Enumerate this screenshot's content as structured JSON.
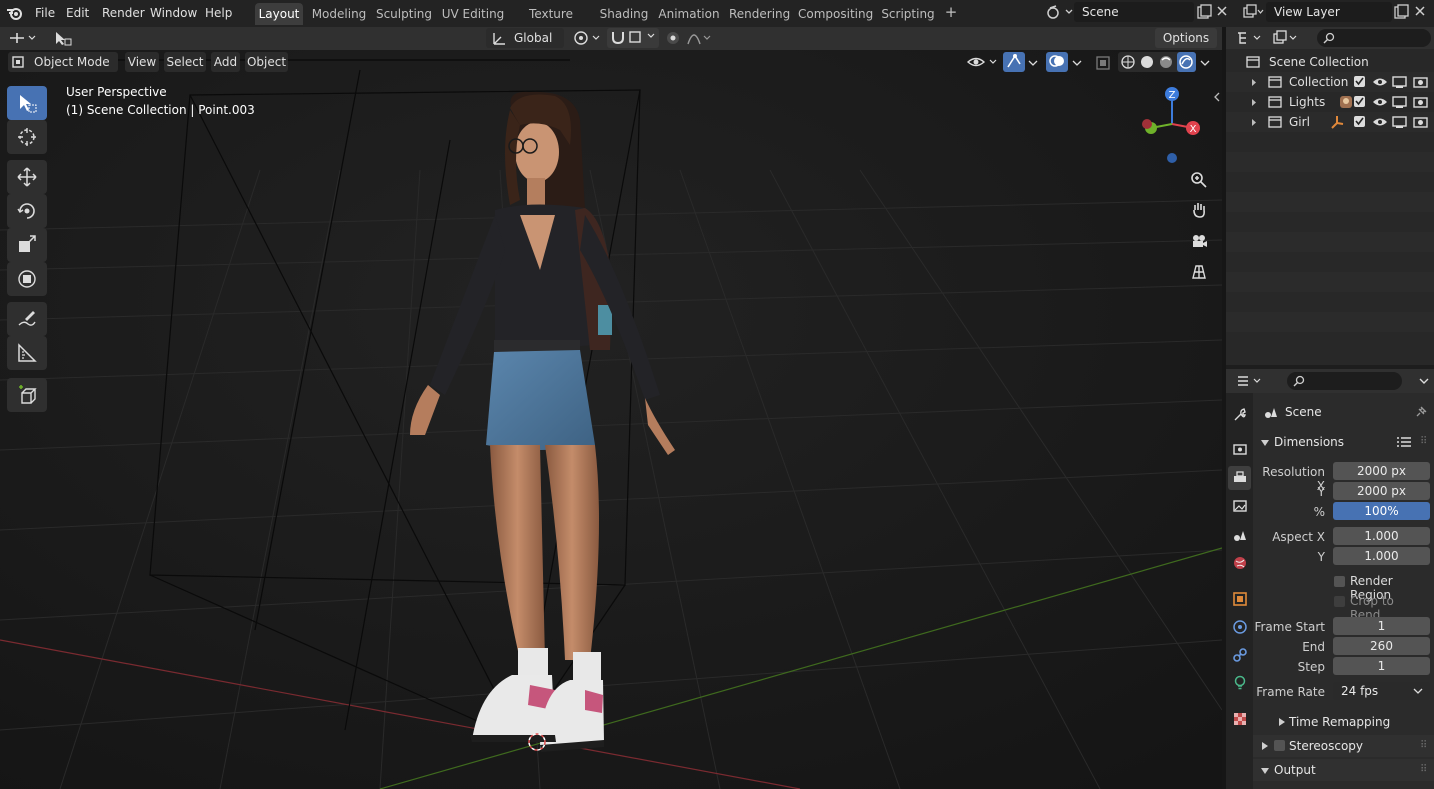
{
  "topbar": {
    "menus": [
      "File",
      "Edit",
      "Render",
      "Window",
      "Help"
    ],
    "workspaces": [
      "Layout",
      "Modeling",
      "Sculpting",
      "UV Editing",
      "Texture Paint",
      "Shading",
      "Animation",
      "Rendering",
      "Compositing",
      "Scripting"
    ],
    "active_workspace": "Layout",
    "scene_name": "Scene",
    "view_layer": "View Layer"
  },
  "viewport_header": {
    "orientation": "Global",
    "options": "Options",
    "mode": "Object Mode",
    "menus": [
      "View",
      "Select",
      "Add",
      "Object"
    ]
  },
  "viewport": {
    "perspective": "User Perspective",
    "context": "(1) Scene Collection | Point.003",
    "gizmo": {
      "z": "Z",
      "x": "X"
    }
  },
  "outliner": {
    "root": "Scene Collection",
    "items": [
      {
        "name": "Collection"
      },
      {
        "name": "Lights"
      },
      {
        "name": "Girl"
      }
    ]
  },
  "properties": {
    "context": "Scene",
    "dimensions": {
      "title": "Dimensions",
      "resolution_x_label": "Resolution X",
      "resolution_x": "2000 px",
      "y_label": "Y",
      "resolution_y": "2000 px",
      "percent_label": "%",
      "percent": "100%",
      "aspect_x_label": "Aspect X",
      "aspect_x": "1.000",
      "aspect_y_label": "Y",
      "aspect_y": "1.000",
      "render_region": "Render Region",
      "crop": "Crop to Rend...",
      "frame_start_label": "Frame Start",
      "frame_start": "1",
      "end_label": "End",
      "frame_end": "260",
      "step_label": "Step",
      "frame_step": "1",
      "frame_rate_label": "Frame Rate",
      "frame_rate": "24 fps",
      "time_remapping": "Time Remapping"
    },
    "stereoscopy": "Stereoscopy",
    "output": "Output"
  },
  "colors": {
    "accent": "#4772b3",
    "axis_x": "#e0424d",
    "axis_y": "#6fb22a",
    "axis_z": "#3d7cdc"
  }
}
